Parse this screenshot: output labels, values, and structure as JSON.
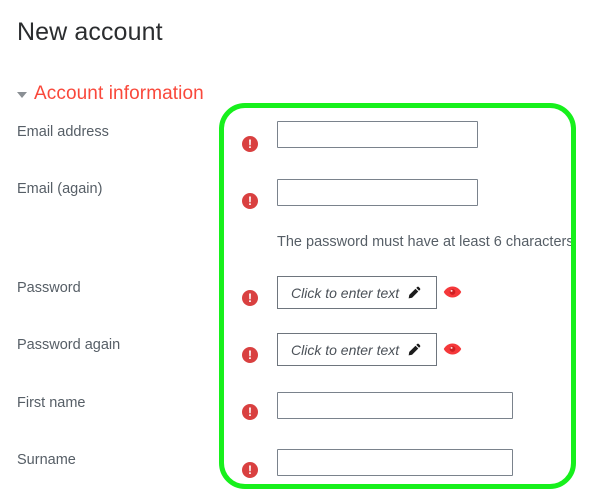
{
  "page": {
    "title": "New account"
  },
  "section": {
    "caret_icon": "chevron-down-icon",
    "title": "Account information",
    "expanded": true
  },
  "highlight": {
    "color": "#17f01c",
    "shape": "rounded-rectangle"
  },
  "colors": {
    "section_title": "#f9483b",
    "label": "#565e66",
    "error_icon": "#d94040",
    "eye_icon": "#f5383a",
    "input_border": "#7a828c",
    "title": "#2b2d2f"
  },
  "form": {
    "fields": [
      {
        "label": "Email address",
        "name": "email-address",
        "type": "text",
        "value": "",
        "placeholder": "",
        "width": "narrow",
        "error_icon": "error-icon",
        "has_reveal": false
      },
      {
        "label": "Email (again)",
        "name": "email-again",
        "type": "text",
        "value": "",
        "placeholder": "",
        "width": "narrow",
        "error_icon": "error-icon",
        "has_reveal": false
      },
      {
        "label": "Password",
        "name": "password",
        "type": "password",
        "value": "",
        "placeholder": "Click to enter text",
        "width": "password",
        "error_icon": "error-icon",
        "has_reveal": true,
        "reveal_icon": "eye-icon",
        "edit_icon": "pencil-icon"
      },
      {
        "label": "Password again",
        "name": "password-again",
        "type": "password",
        "value": "",
        "placeholder": "Click to enter text",
        "width": "password",
        "error_icon": "error-icon",
        "has_reveal": true,
        "reveal_icon": "eye-icon",
        "edit_icon": "pencil-icon"
      },
      {
        "label": "First name",
        "name": "first-name",
        "type": "text",
        "value": "",
        "placeholder": "",
        "width": "wide",
        "error_icon": "error-icon",
        "has_reveal": false
      },
      {
        "label": "Surname",
        "name": "surname",
        "type": "text",
        "value": "",
        "placeholder": "",
        "width": "wide",
        "error_icon": "error-icon",
        "has_reveal": false
      }
    ],
    "password_hint": "The password must have at least 6 characters",
    "error_glyph": "!"
  }
}
